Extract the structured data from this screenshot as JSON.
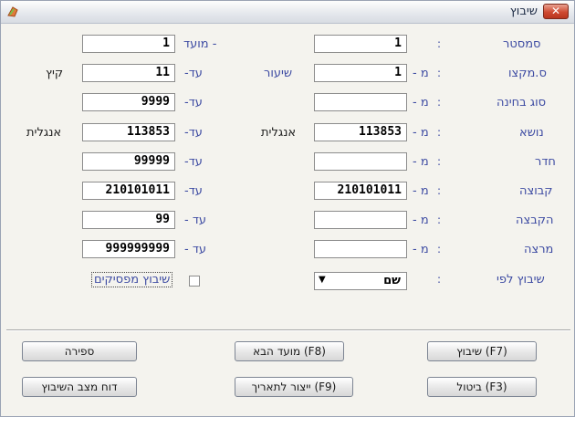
{
  "window": {
    "title": "שיבוץ",
    "close_glyph": "✕"
  },
  "labels": {
    "semester": "סמסטר",
    "moed": "מועד -",
    "sem_course": "ס.מקצו",
    "shiur": "שיעור",
    "exam_type": "סוג בחינה",
    "subject": "נושא",
    "room": "חדר",
    "group": "קבוצה",
    "allocation": "הקבצה",
    "lecturer": "מרצה",
    "sort_by": "שיבוץ לפי",
    "colon": ":",
    "from_dash": "- מ",
    "to_dash": "-עד",
    "to_dash_spaced": "- עד"
  },
  "fields": {
    "semester_value": "1",
    "moed_value": "1",
    "course_from": "1",
    "course_to": "11",
    "course_to_side": "קיץ",
    "exam_type_from": "",
    "exam_type_to": "9999",
    "subject_from": "113853",
    "subject_from_side": "אנגלית",
    "subject_to": "113853",
    "subject_to_side": "אנגלית",
    "room_from": "",
    "room_to": "99999",
    "group_from": "210101011",
    "group_to": "210101011",
    "allocation_from": "",
    "allocation_to": "99",
    "lecturer_from": "",
    "lecturer_to": "999999999"
  },
  "sort_by": {
    "value": "שם"
  },
  "checkbox": {
    "label": "שיבוץ מפסיקים",
    "checked": false
  },
  "buttons": {
    "assign": "שיבוץ (F7)",
    "next_moed": "מועד הבא (F8)",
    "count": "ספירה",
    "cancel": "ביטול (F3)",
    "export_date": "ייצור לתאריך (F9)",
    "status_report": "דוח מצב השיבוץ"
  },
  "colors": {
    "label": "#3e4ca3",
    "close": "#cf4a31"
  }
}
